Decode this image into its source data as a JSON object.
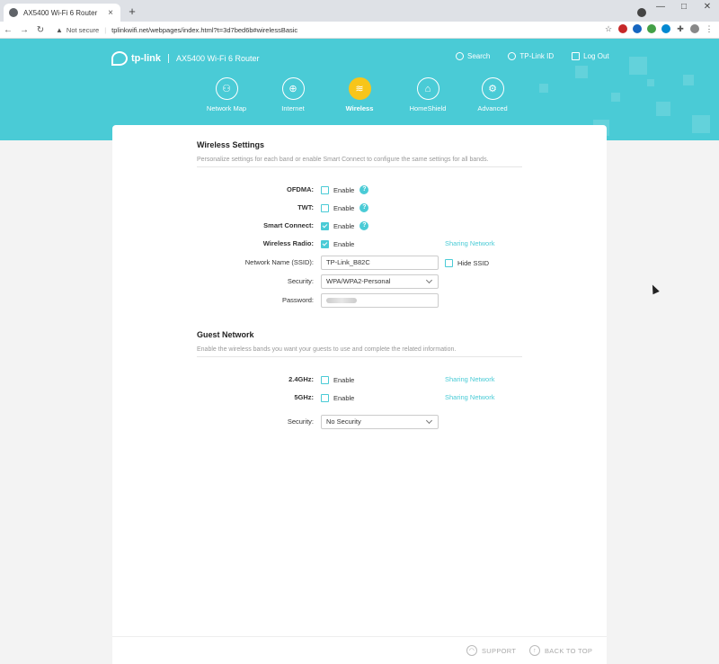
{
  "browser": {
    "tab_title": "AX5400 Wi-Fi 6 Router",
    "tab_close": "×",
    "new_tab": "+",
    "not_secure": "Not secure",
    "url": "tplinkwifi.net/webpages/index.html?t=3d7bed6b#wirelessBasic"
  },
  "header": {
    "logo_text": "tp-link",
    "model": "AX5400 Wi-Fi 6 Router",
    "links": [
      "Search",
      "TP-Link ID",
      "Log Out"
    ]
  },
  "nav": {
    "tabs": [
      "Network Map",
      "Internet",
      "Wireless",
      "HomeShield",
      "Advanced"
    ],
    "active": "Wireless"
  },
  "wireless": {
    "title": "Wireless Settings",
    "desc": "Personalize settings for each band or enable Smart Connect to configure the same settings for all bands.",
    "ofdma_label": "OFDMA:",
    "twt_label": "TWT:",
    "smart_connect_label": "Smart Connect:",
    "radio_label": "Wireless Radio:",
    "ssid_label": "Network Name (SSID):",
    "ssid_value": "TP-Link_B82C",
    "hide_ssid": "Hide SSID",
    "security_label": "Security:",
    "security_value": "WPA/WPA2-Personal",
    "password_label": "Password:",
    "enable": "Enable",
    "sharing": "Sharing Network",
    "help": "?",
    "ofdma_checked": false,
    "twt_checked": false,
    "smart_connect_checked": true,
    "radio_checked": true,
    "hide_ssid_checked": false
  },
  "guest": {
    "title": "Guest Network",
    "desc": "Enable the wireless bands you want your guests to use and complete the related information.",
    "band_24_label": "2.4GHz:",
    "band_5_label": "5GHz:",
    "enable": "Enable",
    "sharing": "Sharing Network",
    "security_label": "Security:",
    "security_value": "No Security"
  },
  "footer": {
    "support": "SUPPORT",
    "back_to_top": "BACK TO TOP"
  },
  "colors": {
    "accent": "#4acbd6",
    "active_nav": "#f7c51a"
  }
}
